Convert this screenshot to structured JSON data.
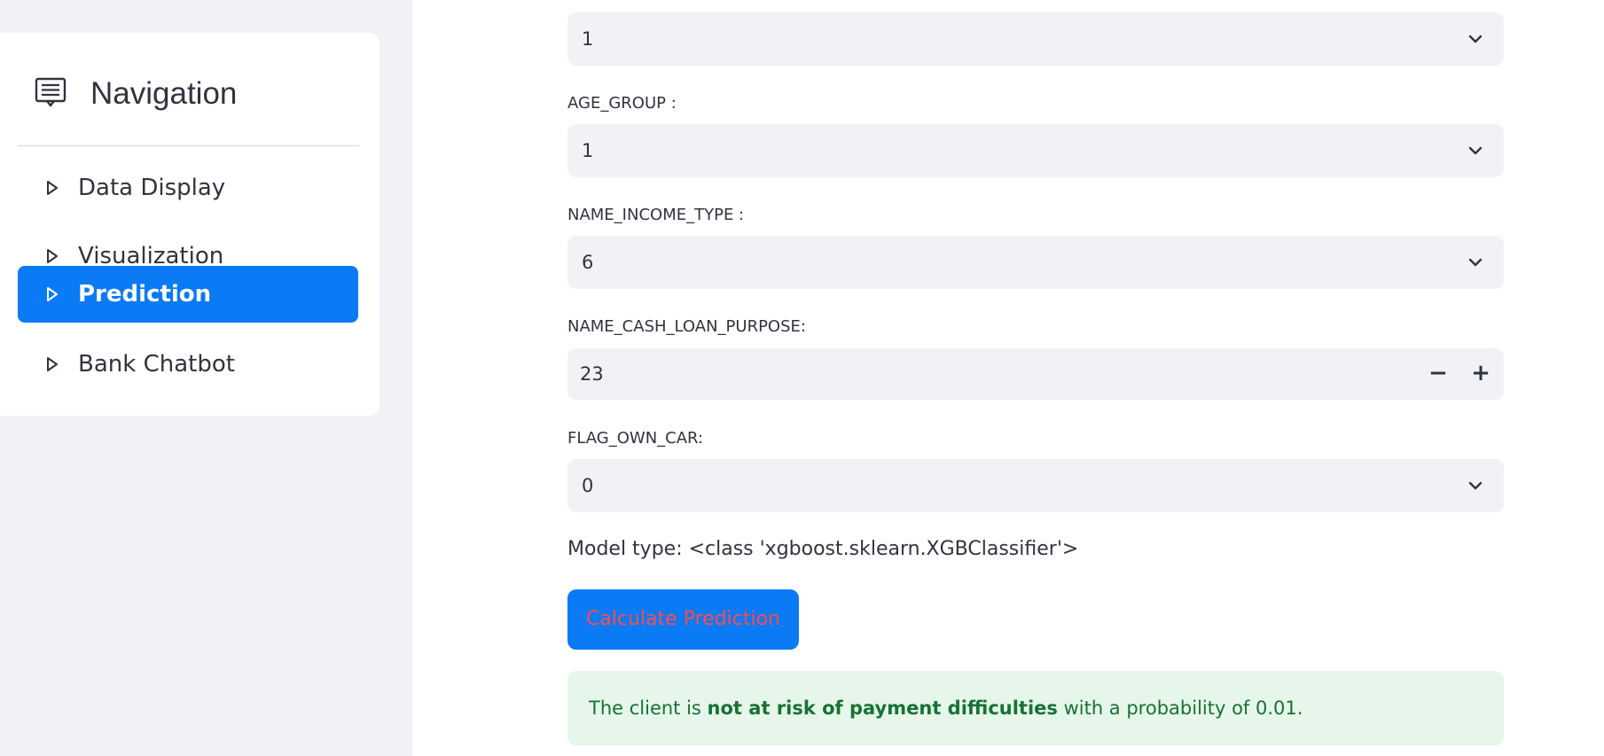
{
  "sidebar": {
    "title": "Navigation",
    "items": [
      {
        "label": "Data Display",
        "active": false
      },
      {
        "label": "Visualization",
        "active": false
      },
      {
        "label": "Prediction",
        "active": true
      },
      {
        "label": "Bank Chatbot",
        "active": false
      }
    ]
  },
  "form": {
    "top_select_value": "1",
    "age_group": {
      "label": "AGE_GROUP :",
      "value": "1"
    },
    "name_income_type": {
      "label": "NAME_INCOME_TYPE :",
      "value": "6"
    },
    "name_cash_loan_purpose": {
      "label": "NAME_CASH_LOAN_PURPOSE:",
      "value": "23",
      "decrement": "−",
      "increment": "+"
    },
    "flag_own_car": {
      "label": "FLAG_OWN_CAR:",
      "value": "0"
    }
  },
  "model_type_text": "Model type: <class 'xgboost.sklearn.XGBClassifier'>",
  "calculate_button_label": "Calculate Prediction",
  "result": {
    "prefix": "The client is ",
    "emphasis": "not at risk of payment difficulties",
    "suffix": " with a probability of 0.01."
  },
  "colors": {
    "accent": "#0a7af5",
    "button_text": "#ff4b4b",
    "success_bg": "#e6f6ea",
    "success_text": "#177233",
    "sidebar_bg": "#f0f2f6"
  },
  "icons": [
    "notes-icon",
    "triangle-right-icon",
    "chevron-down-icon"
  ]
}
